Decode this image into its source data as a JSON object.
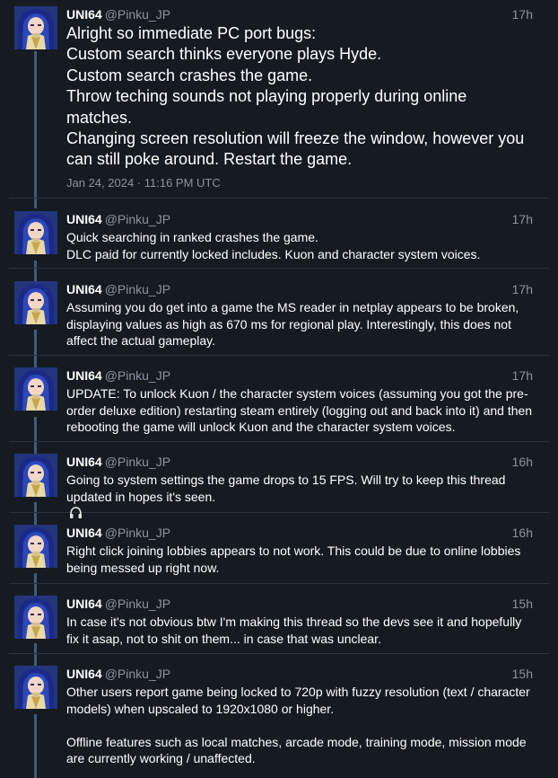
{
  "author": {
    "name": "UNI64",
    "handle": "@Pinku_JP"
  },
  "main_tweet": {
    "time": "17h",
    "lines": [
      "Alright so immediate PC port bugs:",
      "Custom search thinks everyone plays Hyde.",
      "Custom search crashes the game.",
      "Throw teching sounds not playing properly during online",
      "matches.",
      "Changing screen resolution will freeze the window, however you",
      "can still poke around. Restart the game."
    ],
    "date": "Jan 24, 2024 · 11:16 PM UTC"
  },
  "replies": [
    {
      "time": "17h",
      "lines": [
        "Quick searching in ranked crashes the game.",
        "DLC paid for currently locked includes. Kuon and character system voices."
      ]
    },
    {
      "time": "17h",
      "lines": [
        "Assuming you do get into a game the MS reader in netplay appears to be broken,",
        "displaying values as high as 670 ms for regional play. Interestingly, this does not",
        "affect the actual gameplay."
      ]
    },
    {
      "time": "17h",
      "lines": [
        "UPDATE: To unlock Kuon / the character system voices (assuming you got the pre-",
        "order deluxe edition) restarting steam entirely (logging out and back into it) and then",
        "rebooting the game will unlock Kuon and the character system voices."
      ]
    },
    {
      "time": "16h",
      "lines": [
        "Going to system settings the game drops to 15 FPS. Will try to keep this thread",
        "updated in hopes it's seen."
      ],
      "emoji": "headphones-emoji"
    },
    {
      "time": "16h",
      "lines": [
        "Right click joining lobbies appears to not work. This could be due to online lobbies",
        "being messed up right now."
      ]
    },
    {
      "time": "15h",
      "lines": [
        "In case it's not obvious btw I'm making this thread so the devs see it and hopefully",
        "fix it asap, not to shit on them... in case that was unclear."
      ]
    },
    {
      "time": "15h",
      "lines": [
        "Other users report game being locked to 720p with fuzzy resolution (text / character",
        "models) when upscaled to 1920x1080 or higher.",
        "",
        "Offline features such as local matches, arcade mode, training mode, mission mode",
        "are currently working / unaffected."
      ]
    }
  ],
  "colors": {
    "background": "#161b22",
    "rail": "#3d5d7f",
    "muted_text": "#8b949e",
    "divider": "#2c323b"
  }
}
